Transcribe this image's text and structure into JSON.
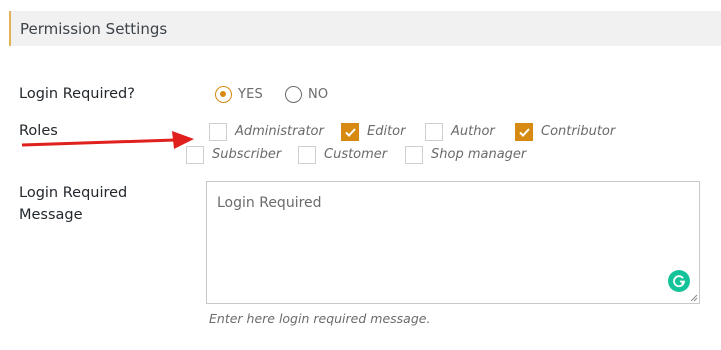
{
  "panel": {
    "title": "Permission Settings"
  },
  "login_required": {
    "label": "Login Required?",
    "options": [
      {
        "label": "YES",
        "selected": true
      },
      {
        "label": "NO",
        "selected": false
      }
    ]
  },
  "roles": {
    "label": "Roles",
    "items": [
      {
        "label": "Administrator",
        "checked": false
      },
      {
        "label": "Editor",
        "checked": true
      },
      {
        "label": "Author",
        "checked": false
      },
      {
        "label": "Contributor",
        "checked": true
      },
      {
        "label": "Subscriber",
        "checked": false
      },
      {
        "label": "Customer",
        "checked": false
      },
      {
        "label": "Shop manager",
        "checked": false
      }
    ]
  },
  "message": {
    "label_line1": "Login Required",
    "label_line2": "Message",
    "placeholder": "Login Required",
    "hint": "Enter here login required message."
  },
  "colors": {
    "accent": "#d68a12",
    "arrow": "#e0201c",
    "grammarly": "#15c39a"
  }
}
